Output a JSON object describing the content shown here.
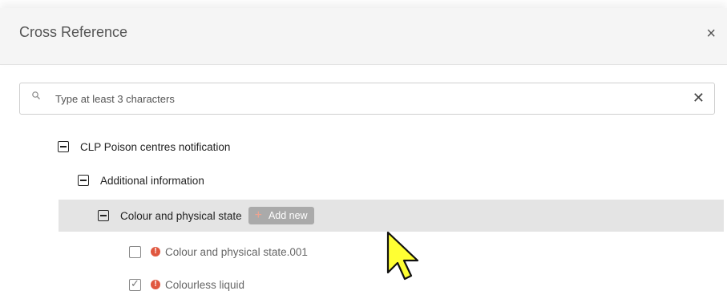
{
  "dialog": {
    "title": "Cross Reference",
    "close_glyph": "×"
  },
  "search": {
    "placeholder": "Type at least 3 characters",
    "value": "",
    "clear_glyph": "✕"
  },
  "tree": {
    "root_label": "CLP Poison centres notification",
    "level1_label": "Additional information",
    "level2_label": "Colour and physical state",
    "add_new_plus": "+",
    "add_new_label": "Add new",
    "items": [
      {
        "label": "Colour and physical state.001",
        "checked": false,
        "status_glyph": "!"
      },
      {
        "label": "Colourless liquid",
        "checked": true,
        "status_glyph": "!"
      }
    ]
  },
  "colors": {
    "highlight": "#e4e4e4",
    "error_dot": "#e0573f",
    "add_button": "#aaaaaa",
    "cursor_fill": "#ffff33"
  },
  "icons": {
    "search": "search-icon",
    "close": "close-icon",
    "clear": "clear-icon",
    "collapse": "minus-square-icon",
    "error": "error-dot-icon",
    "pointer": "mouse-pointer-icon"
  }
}
